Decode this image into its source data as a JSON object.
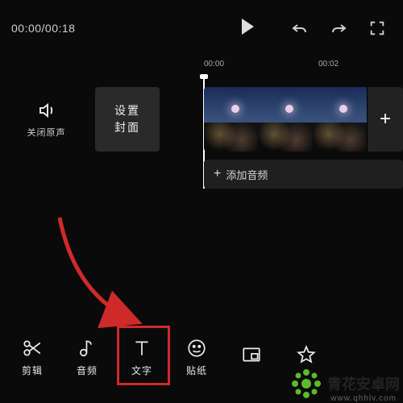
{
  "timecode": {
    "current": "00:00",
    "total": "00:18",
    "display": "00:00/00:18"
  },
  "ruler": {
    "t0": "00:00",
    "t1": "00:02"
  },
  "mute": {
    "label": "关闭原声"
  },
  "cover": {
    "line1": "设置",
    "line2": "封面"
  },
  "audio_track": {
    "label": "添加音频",
    "plus": "+"
  },
  "add_clip": {
    "glyph": "+"
  },
  "tools": [
    {
      "id": "cut",
      "label": "剪辑"
    },
    {
      "id": "audio",
      "label": "音频"
    },
    {
      "id": "text",
      "label": "文字"
    },
    {
      "id": "sticker",
      "label": "贴纸"
    }
  ],
  "watermark": {
    "name": "青花安卓网",
    "url": "www.qhhlv.com"
  },
  "colors": {
    "highlight": "#cf2a2a",
    "arrow": "#cf2a2a",
    "brand_green": "#5bbb2b"
  }
}
